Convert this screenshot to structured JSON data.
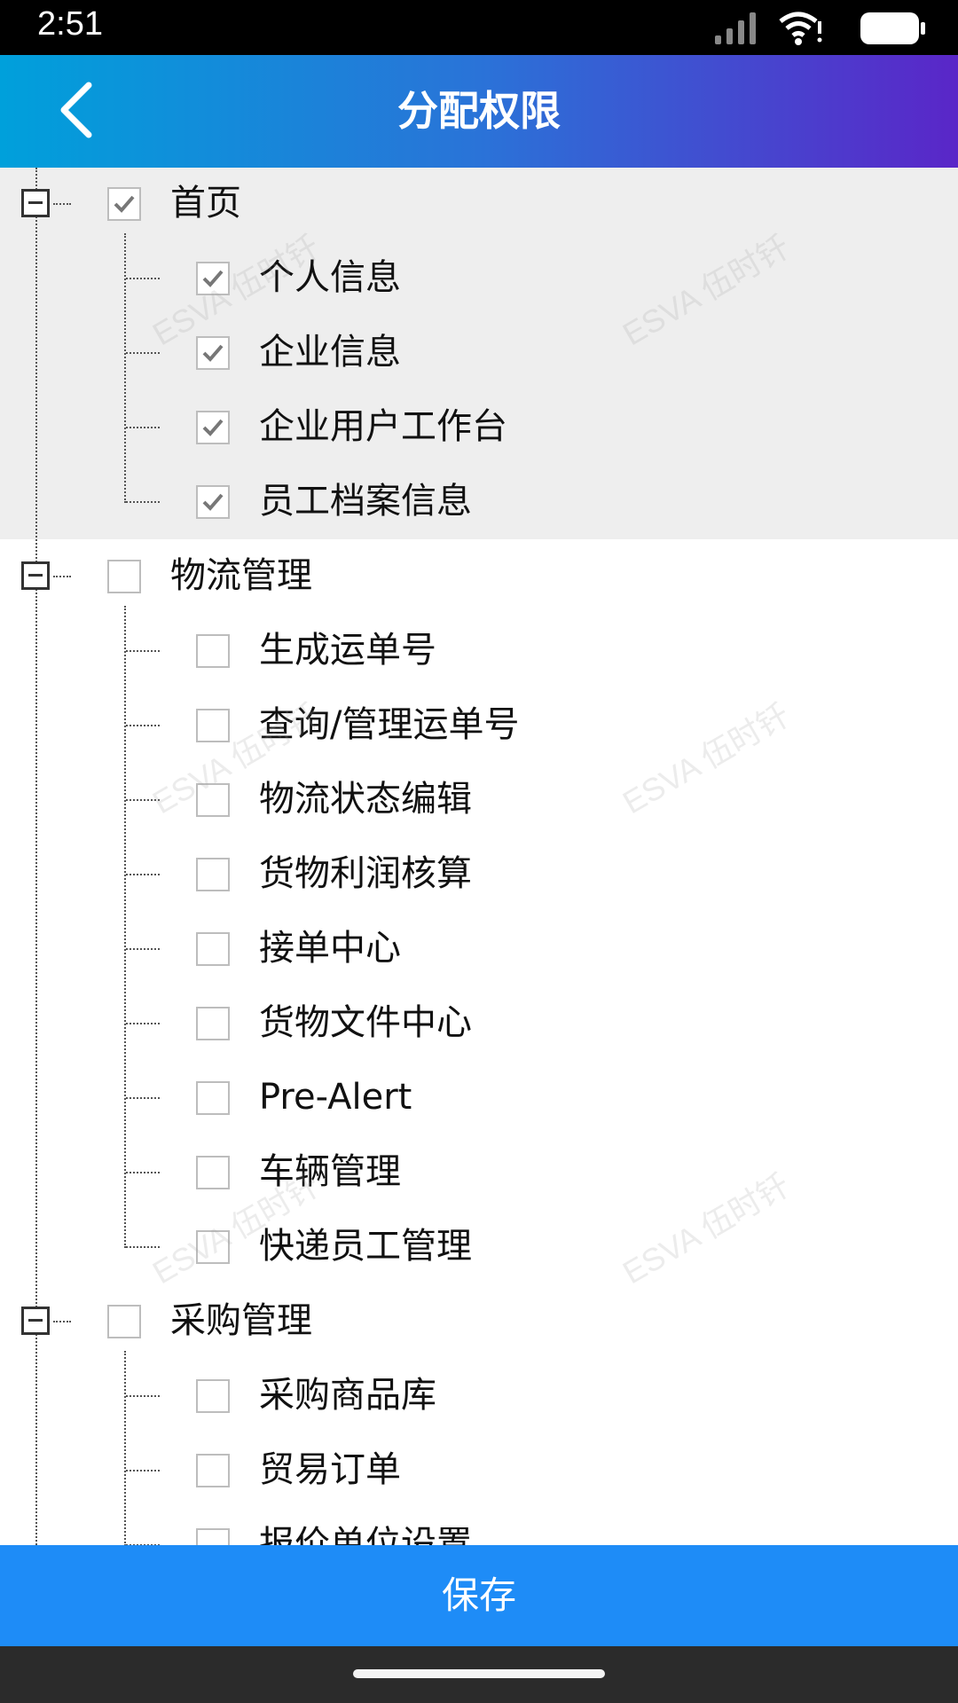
{
  "status_bar": {
    "time": "2:51"
  },
  "header": {
    "title": "分配权限"
  },
  "watermark": "ESVA 伍时钎",
  "tree": [
    {
      "label": "首页",
      "checked": true,
      "children": [
        {
          "label": "个人信息",
          "checked": true
        },
        {
          "label": "企业信息",
          "checked": true
        },
        {
          "label": "企业用户工作台",
          "checked": true
        },
        {
          "label": "员工档案信息",
          "checked": true
        }
      ]
    },
    {
      "label": "物流管理",
      "checked": false,
      "children": [
        {
          "label": "生成运单号",
          "checked": false
        },
        {
          "label": "查询/管理运单号",
          "checked": false
        },
        {
          "label": "物流状态编辑",
          "checked": false
        },
        {
          "label": "货物利润核算",
          "checked": false
        },
        {
          "label": "接单中心",
          "checked": false
        },
        {
          "label": "货物文件中心",
          "checked": false
        },
        {
          "label": "Pre-Alert",
          "checked": false
        },
        {
          "label": "车辆管理",
          "checked": false
        },
        {
          "label": "快递员工管理",
          "checked": false
        }
      ]
    },
    {
      "label": "采购管理",
      "checked": false,
      "children": [
        {
          "label": "采购商品库",
          "checked": false
        },
        {
          "label": "贸易订单",
          "checked": false
        },
        {
          "label": "报价单位设置",
          "checked": false
        }
      ]
    }
  ],
  "footer": {
    "save_label": "保存"
  }
}
